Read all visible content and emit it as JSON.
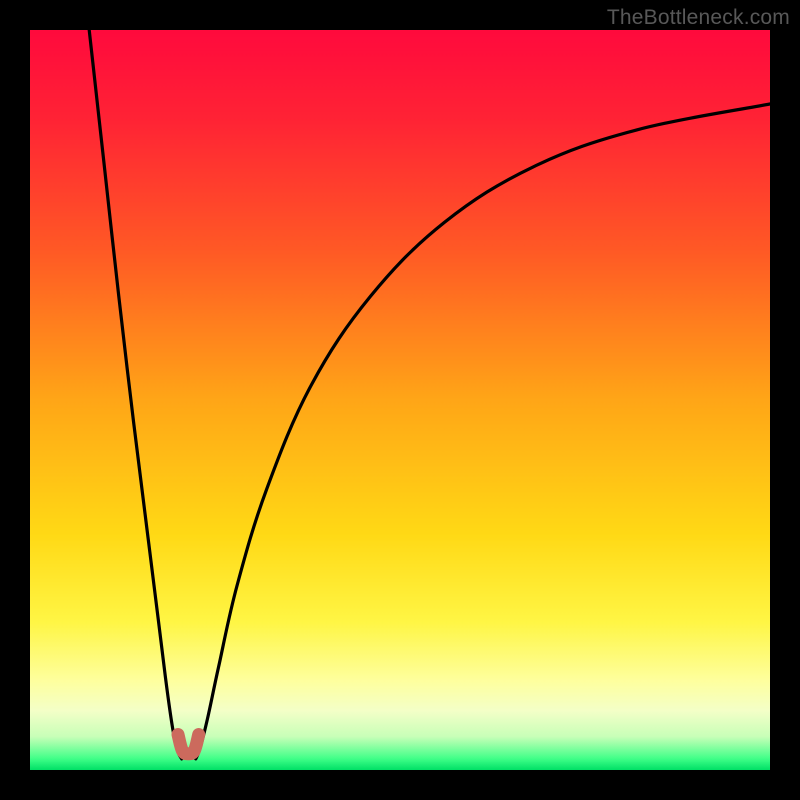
{
  "watermark": {
    "text": "TheBottleneck.com"
  },
  "colors": {
    "frame": "#000000",
    "curve": "#000000",
    "marker_fill": "#cc6a5d",
    "marker_stroke": "#b7564a",
    "gradient_stops": [
      {
        "pos": 0.0,
        "color": "#ff0a3d"
      },
      {
        "pos": 0.12,
        "color": "#ff2335"
      },
      {
        "pos": 0.3,
        "color": "#ff5a25"
      },
      {
        "pos": 0.5,
        "color": "#ffa617"
      },
      {
        "pos": 0.68,
        "color": "#ffd915"
      },
      {
        "pos": 0.8,
        "color": "#fff645"
      },
      {
        "pos": 0.88,
        "color": "#feff9f"
      },
      {
        "pos": 0.92,
        "color": "#f4ffc8"
      },
      {
        "pos": 0.955,
        "color": "#c8ffb8"
      },
      {
        "pos": 0.985,
        "color": "#3fff88"
      },
      {
        "pos": 1.0,
        "color": "#00e066"
      }
    ]
  },
  "chart_data": {
    "type": "line",
    "title": "",
    "xlabel": "",
    "ylabel": "",
    "xlim": [
      0,
      100
    ],
    "ylim": [
      0,
      100
    ],
    "legend": false,
    "grid": false,
    "series": [
      {
        "name": "left-branch",
        "x": [
          8.0,
          10.0,
          12.0,
          14.0,
          16.0,
          17.5,
          18.5,
          19.3,
          20.0,
          20.5
        ],
        "y": [
          100.0,
          82.0,
          64.0,
          47.0,
          31.0,
          19.0,
          11.0,
          5.5,
          2.5,
          1.5
        ]
      },
      {
        "name": "right-branch",
        "x": [
          22.4,
          23.0,
          24.0,
          25.5,
          28.0,
          32.0,
          38.0,
          46.0,
          56.0,
          68.0,
          82.0,
          100.0
        ],
        "y": [
          1.5,
          3.0,
          7.0,
          14.0,
          25.0,
          38.0,
          52.0,
          64.0,
          74.0,
          81.5,
          86.5,
          90.0
        ]
      },
      {
        "name": "bottom-u",
        "x": [
          20.0,
          20.6,
          21.4,
          22.2,
          22.8
        ],
        "y": [
          4.8,
          2.6,
          2.2,
          2.6,
          4.8
        ]
      }
    ],
    "minimum_marker": {
      "x_center": 21.4,
      "y_bottom": 2.2,
      "width_x": 3.2,
      "height_y": 3.8
    },
    "annotations": []
  }
}
